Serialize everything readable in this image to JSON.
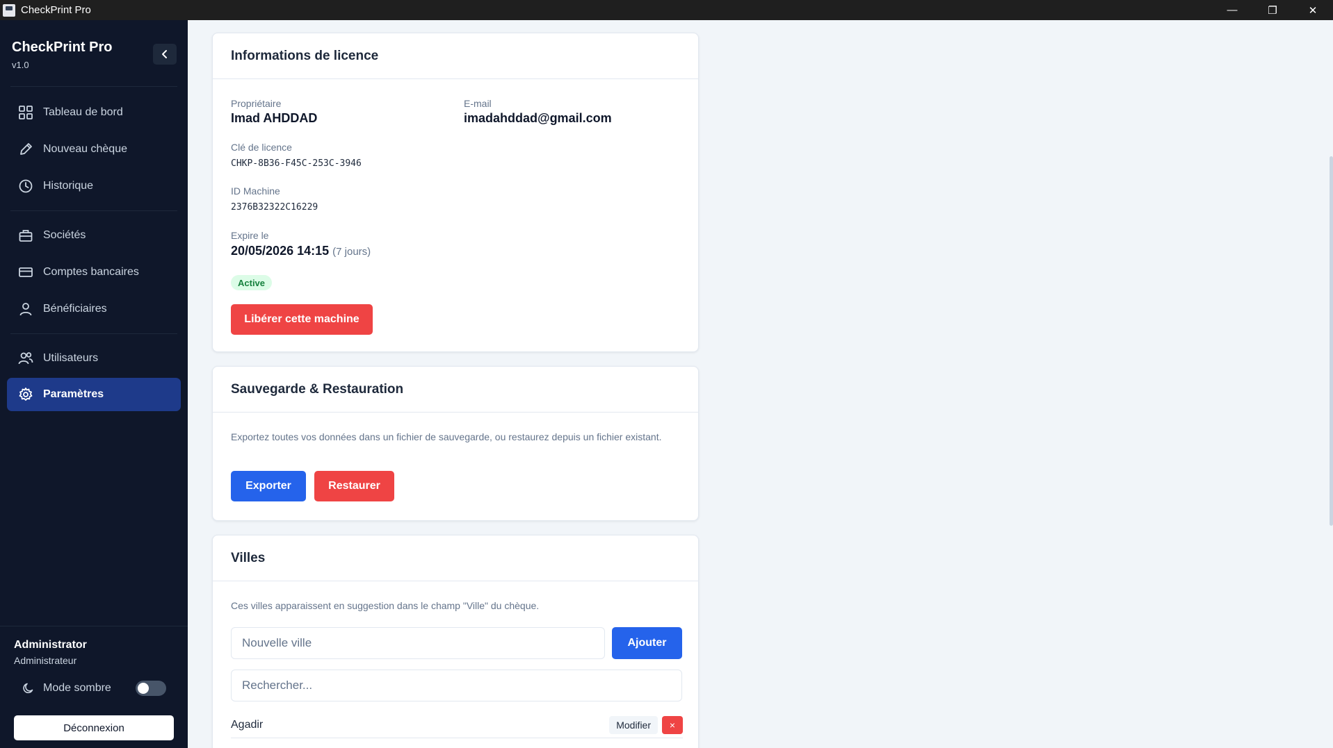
{
  "window": {
    "title": "CheckPrint Pro",
    "minimize": "—",
    "maximize": "❐",
    "close": "✕"
  },
  "sidebar": {
    "app_name": "CheckPrint Pro",
    "version": "v1.0",
    "collapse_icon": "chevron-left-icon",
    "items": [
      {
        "label": "Tableau de bord",
        "icon": "grid-icon"
      },
      {
        "label": "Nouveau chèque",
        "icon": "pencil-icon"
      },
      {
        "label": "Historique",
        "icon": "clock-icon"
      },
      {
        "label": "Sociétés",
        "icon": "briefcase-icon"
      },
      {
        "label": "Comptes bancaires",
        "icon": "card-icon"
      },
      {
        "label": "Bénéficiaires",
        "icon": "user-icon"
      },
      {
        "label": "Utilisateurs",
        "icon": "users-icon"
      },
      {
        "label": "Paramètres",
        "icon": "gear-icon",
        "active": true
      }
    ],
    "user": {
      "name": "Administrator",
      "role": "Administrateur"
    },
    "dark_mode": {
      "label": "Mode sombre",
      "enabled": false
    },
    "logout_label": "Déconnexion"
  },
  "license": {
    "title": "Informations de licence",
    "owner_label": "Propriétaire",
    "owner": "Imad AHDDAD",
    "email_label": "E-mail",
    "email": "imadahddad@gmail.com",
    "key_label": "Clé de licence",
    "key": "CHKP-8B36-F45C-253C-3946",
    "machine_label": "ID Machine",
    "machine": "2376B32322C16229",
    "expires_label": "Expire le",
    "expires": "20/05/2026 14:15",
    "expires_remaining": "(7 jours)",
    "status": "Active",
    "release_button": "Libérer cette machine"
  },
  "backup": {
    "title": "Sauvegarde & Restauration",
    "description": "Exportez toutes vos données dans un fichier de sauvegarde, ou restaurez depuis un fichier existant.",
    "export_button": "Exporter",
    "restore_button": "Restaurer"
  },
  "cities": {
    "title": "Villes",
    "description": "Ces villes apparaissent en suggestion dans le champ \"Ville\" du chèque.",
    "new_placeholder": "Nouvelle ville",
    "add_button": "Ajouter",
    "search_placeholder": "Rechercher...",
    "edit_label": "Modifier",
    "delete_label": "×",
    "list": [
      "Agadir"
    ]
  },
  "colors": {
    "sidebar_bg": "#0f172a",
    "active_item": "#1e3a8a",
    "primary": "#2563eb",
    "danger": "#ef4444",
    "success": "#15803d"
  }
}
